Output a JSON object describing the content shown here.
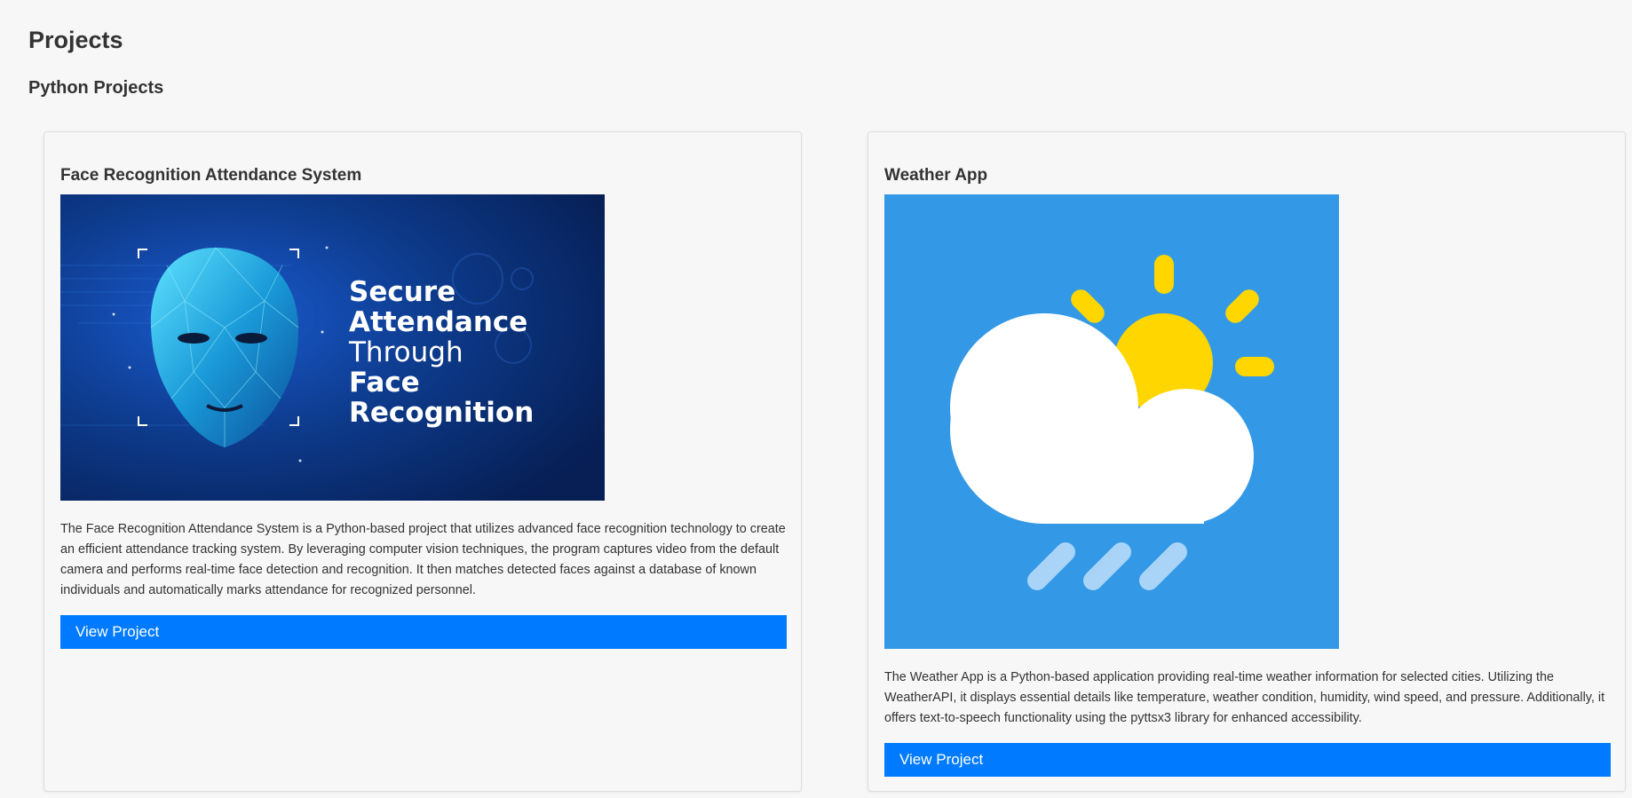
{
  "page": {
    "title": "Projects",
    "section_title": "Python Projects"
  },
  "colors": {
    "background": "#f7f7f7",
    "button": "#007bff",
    "face_image_bg": "#0a2a66",
    "weather_image_bg": "#3399e6",
    "sun": "#ffd600"
  },
  "projects": [
    {
      "title": "Face Recognition Attendance System",
      "image_icon": "face-recognition-banner",
      "image_text": [
        "Secure",
        "Attendance",
        "Through",
        "Face",
        "Recognition"
      ],
      "description": "The Face Recognition Attendance System is a Python-based project that utilizes advanced face recognition technology to create an efficient attendance tracking system. By leveraging computer vision techniques, the program captures video from the default camera and performs real-time face detection and recognition. It then matches detected faces against a database of known individuals and automatically marks attendance for recognized personnel.",
      "button_label": "View Project"
    },
    {
      "title": "Weather App",
      "image_icon": "weather-cloud-sun-rain-icon",
      "description": "The Weather App is a Python-based application providing real-time weather information for selected cities. Utilizing the WeatherAPI, it displays essential details like temperature, weather condition, humidity, wind speed, and pressure. Additionally, it offers text-to-speech functionality using the pyttsx3 library for enhanced accessibility.",
      "button_label": "View Project"
    }
  ]
}
